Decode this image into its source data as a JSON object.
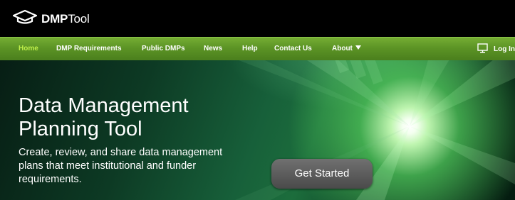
{
  "header": {
    "logo_bold": "DMP",
    "logo_light": "Tool",
    "logo_icon": "mortarboard-icon"
  },
  "nav": {
    "items": [
      {
        "label": "Home",
        "active": true
      },
      {
        "label": "DMP Requirements",
        "active": false
      },
      {
        "label": "Public DMPs",
        "active": false
      },
      {
        "label": "News",
        "active": false
      },
      {
        "label": "Help",
        "active": false
      },
      {
        "label": "Contact Us",
        "active": false
      },
      {
        "label": "About",
        "active": false
      }
    ],
    "login_label": "Log In",
    "login_icon": "monitor-icon"
  },
  "hero": {
    "title": "Data Management Planning Tool",
    "subtitle": "Create, review, and share data management plans that meet institutional and funder requirements.",
    "cta_label": "Get Started"
  },
  "colors": {
    "nav_bar": "#5c9425",
    "active_nav": "#bfef4a",
    "header_bg": "#000000",
    "button_bg": "#5c5c5c"
  }
}
